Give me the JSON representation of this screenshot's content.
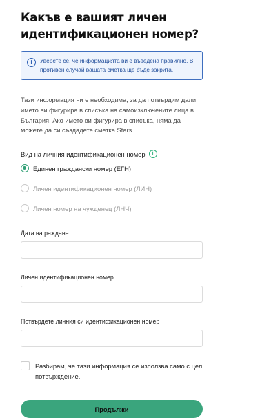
{
  "page": {
    "title": "Какъв е вашият личен идентификационен номер?"
  },
  "notice": {
    "icon": "info-icon",
    "text": "Уверете се, че информацията ви е въведена правилно. В противен случай вашата сметка ще бъде закрита."
  },
  "description": "Тази информация ни е необходима, за да потвърдим дали името ви фигурира в списъка на самоизключените лица в България. Ако името ви фигурира в списъка, няма да можете да си създадете сметка Stars.",
  "id_type": {
    "label": "Вид на личния идентификационен номер",
    "hint_icon": "info-icon",
    "options": [
      {
        "label": "Единен граждански номер (ЕГН)",
        "selected": true
      },
      {
        "label": "Личен идентификационен номер (ЛИН)",
        "selected": false
      },
      {
        "label": "Личен номер на чужденец (ЛНЧ)",
        "selected": false
      }
    ]
  },
  "fields": {
    "birth_date": {
      "label": "Дата на раждане",
      "value": ""
    },
    "id_number": {
      "label": "Личен идентификационен номер",
      "value": ""
    },
    "id_number_confirm": {
      "label": "Потвърдете личния си идентификационен номер",
      "value": ""
    }
  },
  "consent": {
    "checked": false,
    "text": "Разбирам, че тази информация се използва само с цел потвърждение."
  },
  "actions": {
    "continue_label": "Продължи"
  },
  "colors": {
    "accent": "#3aa57d",
    "notice_border": "#3f6fbf",
    "notice_bg": "#eef4fd"
  }
}
